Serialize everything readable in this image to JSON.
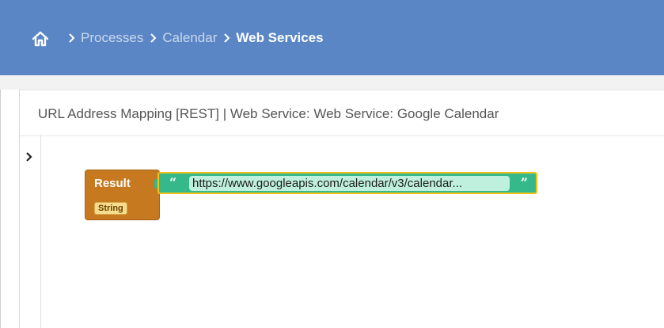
{
  "header": {
    "breadcrumbs": [
      "Processes",
      "Calendar",
      "Web Services"
    ]
  },
  "panel": {
    "title": "URL Address Mapping [REST]  |  Web Service: Web Service: Google Calendar"
  },
  "blocks": {
    "result_label": "Result",
    "type_badge": "String",
    "open_quote": "“",
    "close_quote": "”",
    "url_value": "https://www.googleapis.com/calendar/v3/calendar..."
  },
  "colors": {
    "header_bg": "#5b86c5",
    "result_block": "#c7791f",
    "string_block": "#35b88a",
    "selected_outline": "#f2c21b"
  }
}
